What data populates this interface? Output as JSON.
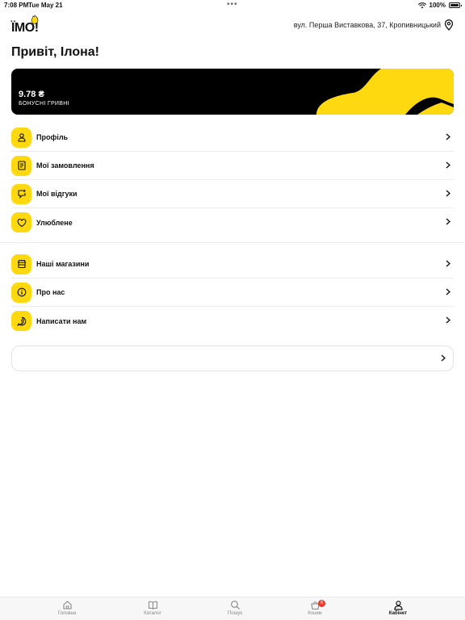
{
  "status": {
    "time": "7:08 PM",
    "date": "Tue May 21",
    "battery": "100%"
  },
  "header": {
    "logo_text": "ЇМО!",
    "address": "вул. Перша Виставкова, 37, Кропивницький"
  },
  "greeting": "Привіт, Ілона!",
  "bonus": {
    "amount": "9.78 ₴",
    "label": "БОНУСНІ ГРИВНІ",
    "accent_color": "#ffd90f"
  },
  "menu_group_1": [
    {
      "label": "Профіль",
      "icon": "user-icon"
    },
    {
      "label": "Мої замовлення",
      "icon": "receipt-icon"
    },
    {
      "label": "Мої відгуки",
      "icon": "review-icon"
    },
    {
      "label": "Улюблене",
      "icon": "heart-icon"
    }
  ],
  "menu_group_2": [
    {
      "label": "Наші магазини",
      "icon": "store-icon"
    },
    {
      "label": "Про нас",
      "icon": "info-icon"
    },
    {
      "label": "Написати нам",
      "icon": "message-alert-icon"
    }
  ],
  "tabs": [
    {
      "label": "Головна",
      "icon": "home-icon"
    },
    {
      "label": "Каталог",
      "icon": "book-icon"
    },
    {
      "label": "Пошук",
      "icon": "search-icon"
    },
    {
      "label": "Кошик",
      "icon": "basket-icon",
      "badge": "0"
    },
    {
      "label": "Кабінет",
      "icon": "user-icon",
      "active": true
    }
  ]
}
